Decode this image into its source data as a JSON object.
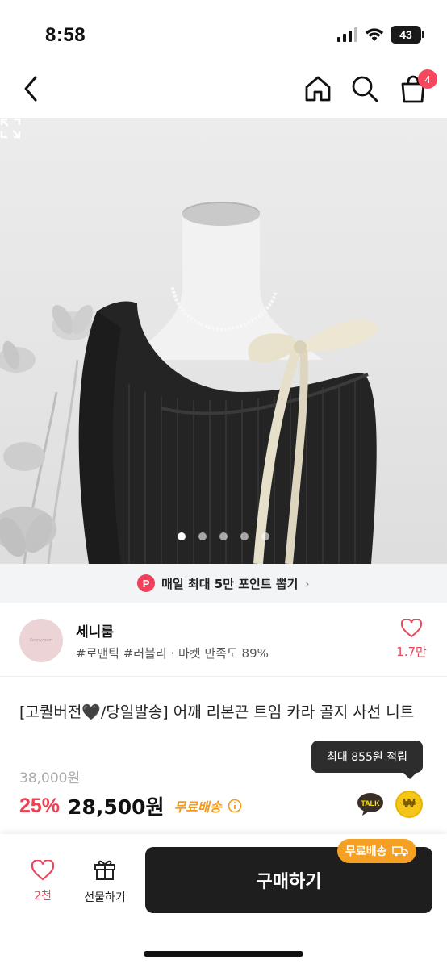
{
  "status_bar": {
    "time": "8:58",
    "battery": "43"
  },
  "nav": {
    "cart_count": "4"
  },
  "gallery": {
    "page_count": 5,
    "active_index": 0
  },
  "points_banner": {
    "badge": "P",
    "text": "매일 최대 5만 포인트 뽑기",
    "arrow": "›"
  },
  "shop": {
    "name": "세니룸",
    "tags": "#로맨틱 #러블리 · 마켓 만족도 89%",
    "like_count": "1.7만",
    "avatar_text": "Sennyroom"
  },
  "product": {
    "title": "[고퀄버전🖤/당일발송] 어깨 리본끈 트임 카라 골지 사선 니트",
    "original_price": "38,000원",
    "discount": "25%",
    "price": "28,500원",
    "free_shipping": "무료배송",
    "tooltip": "최대 855원 적립",
    "talk_label": "TALK",
    "won_label": "₩"
  },
  "bottom_bar": {
    "like_count": "2천",
    "gift_label": "선물하기",
    "buy_label": "구매하기",
    "ship_pill": "무료배송"
  },
  "colors": {
    "accent": "#f03f52",
    "shipping": "#f29b1c",
    "buy_button": "#1e1e1e"
  }
}
